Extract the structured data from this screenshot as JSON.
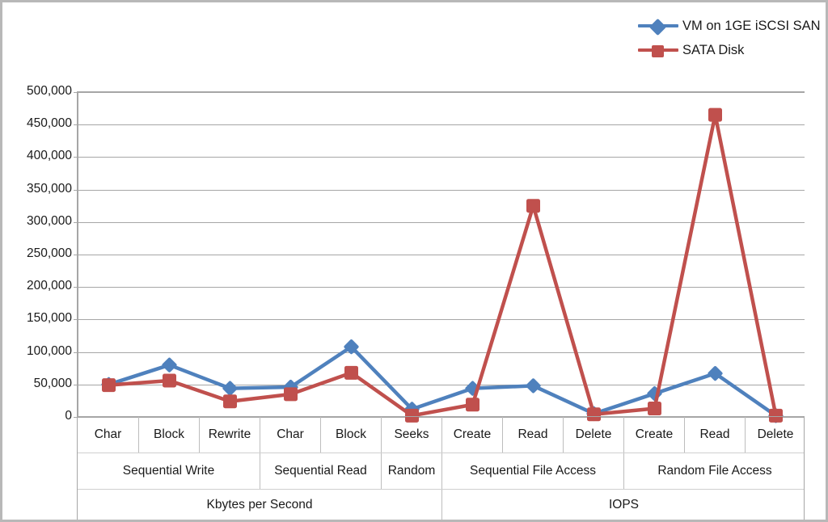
{
  "legend": {
    "position": "top-right",
    "items": [
      {
        "label": "VM on 1GE iSCSI SAN",
        "color": "#4f81bd",
        "marker": "diamond",
        "icon": "line-diamond-marker-icon"
      },
      {
        "label": "SATA Disk",
        "color": "#c0504d",
        "marker": "square",
        "icon": "line-square-marker-icon"
      }
    ]
  },
  "axis": {
    "y_ticks": [
      "0",
      "50,000",
      "100,000",
      "150,000",
      "200,000",
      "250,000",
      "300,000",
      "350,000",
      "400,000",
      "450,000",
      "500,000"
    ]
  },
  "categories_tier1": [
    "Char",
    "Block",
    "Rewrite",
    "Char",
    "Block",
    "Seeks",
    "Create",
    "Read",
    "Delete",
    "Create",
    "Read",
    "Delete"
  ],
  "categories_tier2": [
    {
      "label": "Sequential Write",
      "span": 3
    },
    {
      "label": "Sequential Read",
      "span": 2
    },
    {
      "label": "Random",
      "span": 1
    },
    {
      "label": "Sequential File Access",
      "span": 3
    },
    {
      "label": "Random File Access",
      "span": 3
    }
  ],
  "categories_tier3": [
    {
      "label": "Kbytes per Second",
      "span": 6
    },
    {
      "label": "IOPS",
      "span": 6
    }
  ],
  "chart_data": {
    "type": "line",
    "title": "",
    "xlabel": "",
    "ylabel": "",
    "ylim": [
      0,
      500000
    ],
    "ytick_step": 50000,
    "grid": true,
    "legend_position": "top-right",
    "categories": [
      "Char",
      "Block",
      "Rewrite",
      "Char",
      "Block",
      "Seeks",
      "Create",
      "Read",
      "Delete",
      "Create",
      "Read",
      "Delete"
    ],
    "category_groups": [
      "Sequential Write",
      "Sequential Write",
      "Sequential Write",
      "Sequential Read",
      "Sequential Read",
      "Random",
      "Sequential File Access",
      "Sequential File Access",
      "Sequential File Access",
      "Random File Access",
      "Random File Access",
      "Random File Access"
    ],
    "category_units": [
      "Kbytes per Second",
      "Kbytes per Second",
      "Kbytes per Second",
      "Kbytes per Second",
      "Kbytes per Second",
      "Kbytes per Second",
      "IOPS",
      "IOPS",
      "IOPS",
      "IOPS",
      "IOPS",
      "IOPS"
    ],
    "series": [
      {
        "name": "VM on 1GE iSCSI SAN",
        "color": "#4f81bd",
        "marker": "diamond",
        "values": [
          50000,
          80000,
          44000,
          46000,
          108000,
          12000,
          44000,
          48000,
          5000,
          36000,
          67000,
          2000
        ]
      },
      {
        "name": "SATA Disk",
        "color": "#c0504d",
        "marker": "square",
        "values": [
          49000,
          56000,
          24000,
          35000,
          68000,
          2000,
          19000,
          325000,
          4000,
          13000,
          465000,
          2000
        ]
      }
    ]
  }
}
